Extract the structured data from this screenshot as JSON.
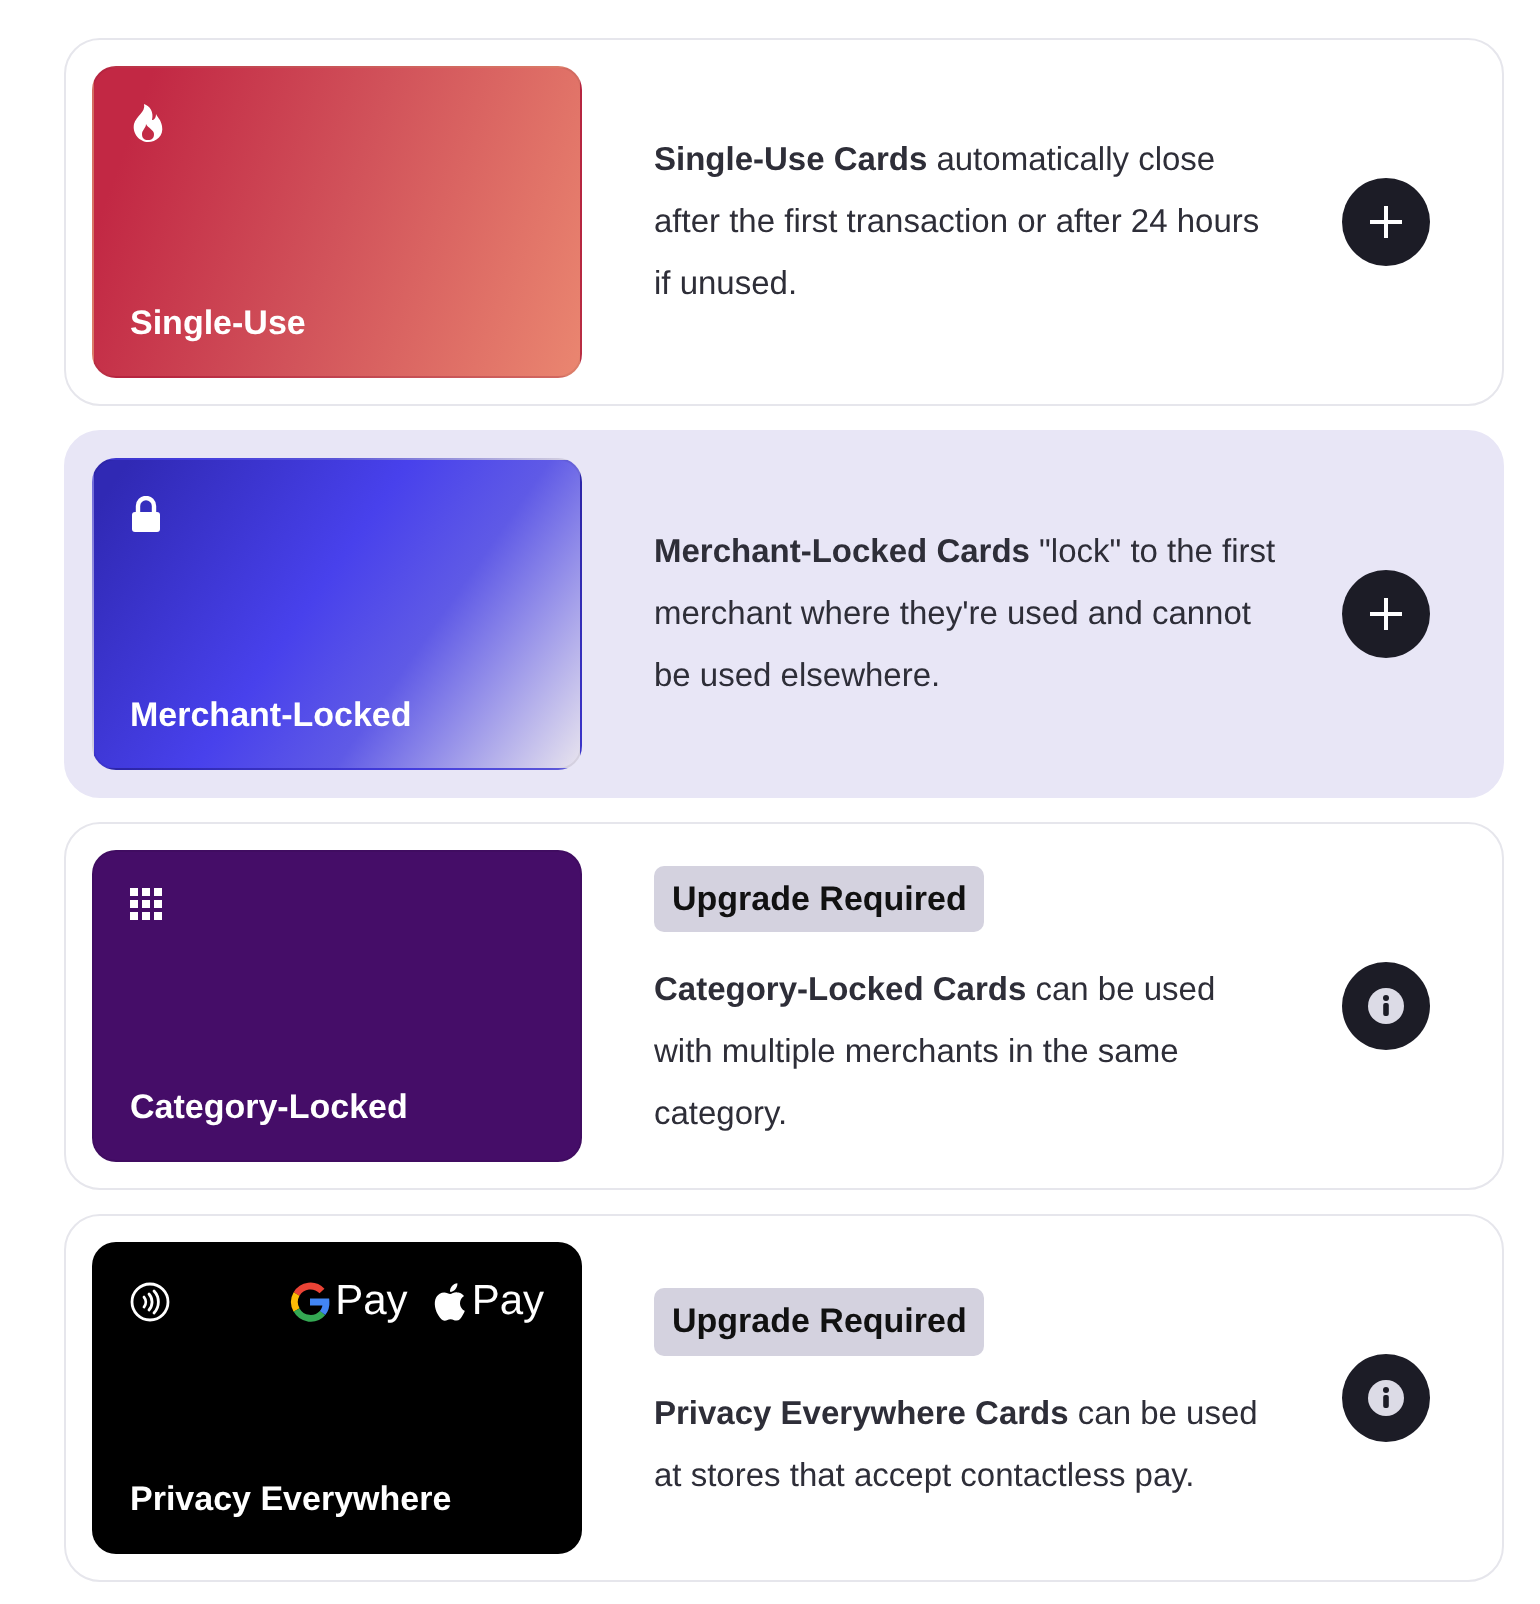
{
  "options": [
    {
      "kind": "single-use",
      "selected": false,
      "card_label": "Single-Use",
      "description": "**Single-Use Cards** automatically close after the first transaction or after 24 hours if unused.",
      "button": {
        "kind": "add"
      }
    },
    {
      "kind": "merchant-locked",
      "selected": true,
      "card_label": "Merchant-Locked",
      "description": "**Merchant-Locked Cards** \"lock\" to the first merchant where they're used and cannot be used elsewhere.",
      "button": {
        "kind": "add"
      }
    },
    {
      "kind": "category-locked",
      "selected": false,
      "card_label": "Category-Locked",
      "badge": "Upgrade Required",
      "description": "**Category-Locked Cards** can be used with multiple merchants in the same category.",
      "button": {
        "kind": "info"
      }
    },
    {
      "kind": "privacy-everywhere",
      "selected": false,
      "card_label": "Privacy Everywhere",
      "wallets": [
        {
          "kind": "google",
          "label": "Pay"
        },
        {
          "kind": "apple",
          "label": "Pay"
        }
      ],
      "badge": "Upgrade Required",
      "description": "**Privacy Everywhere Cards** can be used at stores that accept contactless pay.",
      "button": {
        "kind": "info"
      }
    }
  ]
}
